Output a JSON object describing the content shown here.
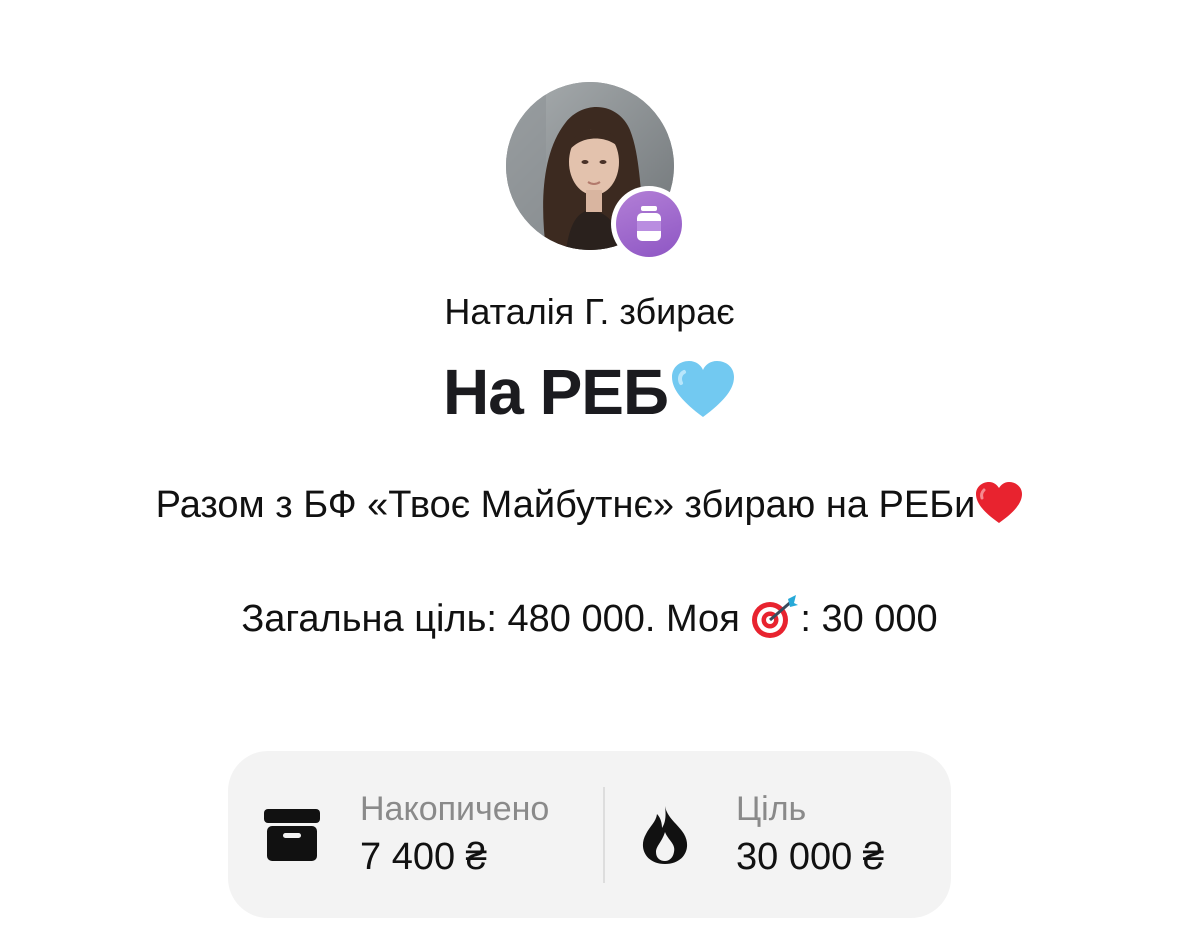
{
  "organizer": {
    "subtitle": "Наталія Г. збирає",
    "badge_icon": "jar-icon",
    "badge_color": "#9b63cc"
  },
  "jar": {
    "title": "На РЕБ",
    "title_emoji": "light-blue-heart"
  },
  "description": {
    "line1": "Разом з БФ «Твоє Майбутнє» збираю на РЕБи",
    "line1_emoji": "red-heart",
    "line2_before": "Загальна ціль: 480 000. Моя ",
    "line2_emoji": "direct-hit-target",
    "line2_after": ": 30 000"
  },
  "stats": {
    "accumulated": {
      "icon": "archive-box-icon",
      "label": "Накопичено",
      "value": "7 400 ₴"
    },
    "goal": {
      "icon": "fire-icon",
      "label": "Ціль",
      "value": "30 000 ₴"
    }
  }
}
